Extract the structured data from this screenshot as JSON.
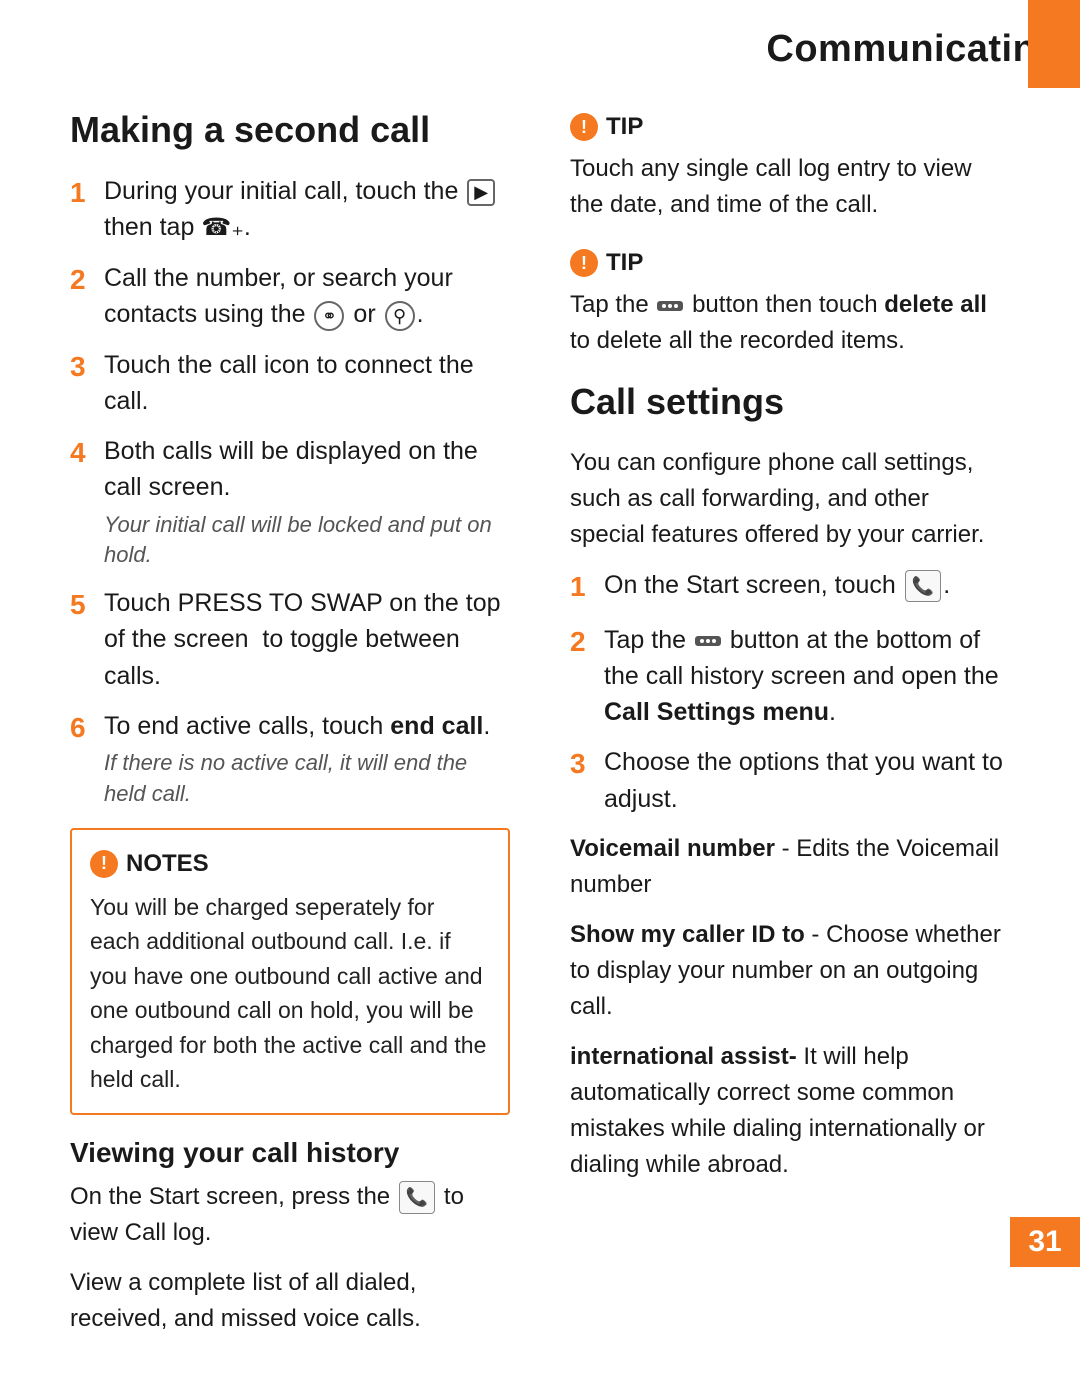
{
  "header": {
    "title": "Communicating",
    "page_number": "31"
  },
  "left_col": {
    "making_second_call": {
      "title": "Making a second call",
      "steps": [
        {
          "num": "1",
          "text": "During your initial call, touch the",
          "icon": "menu",
          "text2": "then tap",
          "icon2": "add-call"
        },
        {
          "num": "2",
          "text": "Call the number, or search your contacts using the",
          "icon": "contacts",
          "text2": "or",
          "icon2": "search"
        },
        {
          "num": "3",
          "text": "Touch the call icon to connect the call."
        },
        {
          "num": "4",
          "text": "Both calls will be displayed on the call screen.",
          "sub": "Your initial call will be locked and put on hold."
        },
        {
          "num": "5",
          "text": "Touch PRESS TO SWAP on the top of the screen  to toggle between calls."
        },
        {
          "num": "6",
          "text_normal": "To end active calls, touch ",
          "text_bold": "end call",
          "text_after": ".",
          "sub": "If there is no active call, it will end the held call."
        }
      ]
    },
    "notes": {
      "header": "NOTES",
      "text": "You will be charged seperately for each additional outbound call. I.e. if you have one outbound call active and one outbound call on hold, you will be charged for both the active call and the held call."
    },
    "viewing_call_history": {
      "title": "Viewing your call history",
      "para1": "On the Start screen, press the",
      "para1_after": "to view Call log.",
      "para2": "View a complete list of all dialed, received, and missed voice calls."
    }
  },
  "right_col": {
    "tip1": {
      "header": "TIP",
      "text": "Touch any single call log entry to view the date, and time of the call."
    },
    "tip2": {
      "header": "TIP",
      "text_before": "Tap the",
      "text_bold": "delete all",
      "text_after": "button then touch",
      "text_end": "to delete all the recorded items."
    },
    "call_settings": {
      "title": "Call settings",
      "intro": "You can configure phone call settings, such as call forwarding, and other special features offered by your carrier.",
      "steps": [
        {
          "num": "1",
          "text": "On the Start screen, touch"
        },
        {
          "num": "2",
          "text_before": "Tap the",
          "text_after": "button at the bottom of the call history screen and open the",
          "text_bold": "Call Settings menu",
          "text_end": "."
        },
        {
          "num": "3",
          "text": "Choose the options that you want to adjust."
        }
      ],
      "options": [
        {
          "bold": "Voicemail number",
          "text": " - Edits the Voicemail number"
        },
        {
          "bold": "Show my caller ID to",
          "text": " - Choose whether to display your number on an outgoing call."
        },
        {
          "bold": "international assist-",
          "text": " It will help automatically correct some common mistakes while dialing internationally or dialing while abroad."
        }
      ]
    }
  }
}
